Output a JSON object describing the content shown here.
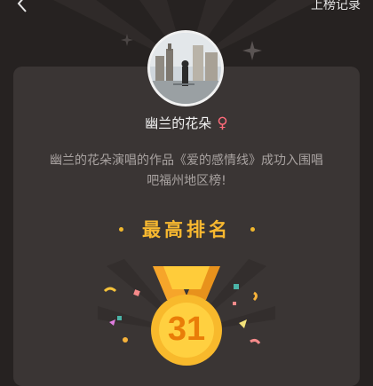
{
  "header": {
    "back_icon": "chevron-left-icon",
    "history_label": "上榜记录"
  },
  "profile": {
    "username": "幽兰的花朵",
    "gender_symbol": "♀"
  },
  "message": {
    "text": "幽兰的花朵演唱的作品《爱的感情线》成功入围唱吧福州地区榜!"
  },
  "rank": {
    "title": "最高排名",
    "number": "31"
  },
  "colors": {
    "background": "#262221",
    "card": "#3a3534",
    "accent_gold": "#f7b830",
    "gender_pink": "#ff6b7a",
    "medal_number": "#e97d08"
  }
}
